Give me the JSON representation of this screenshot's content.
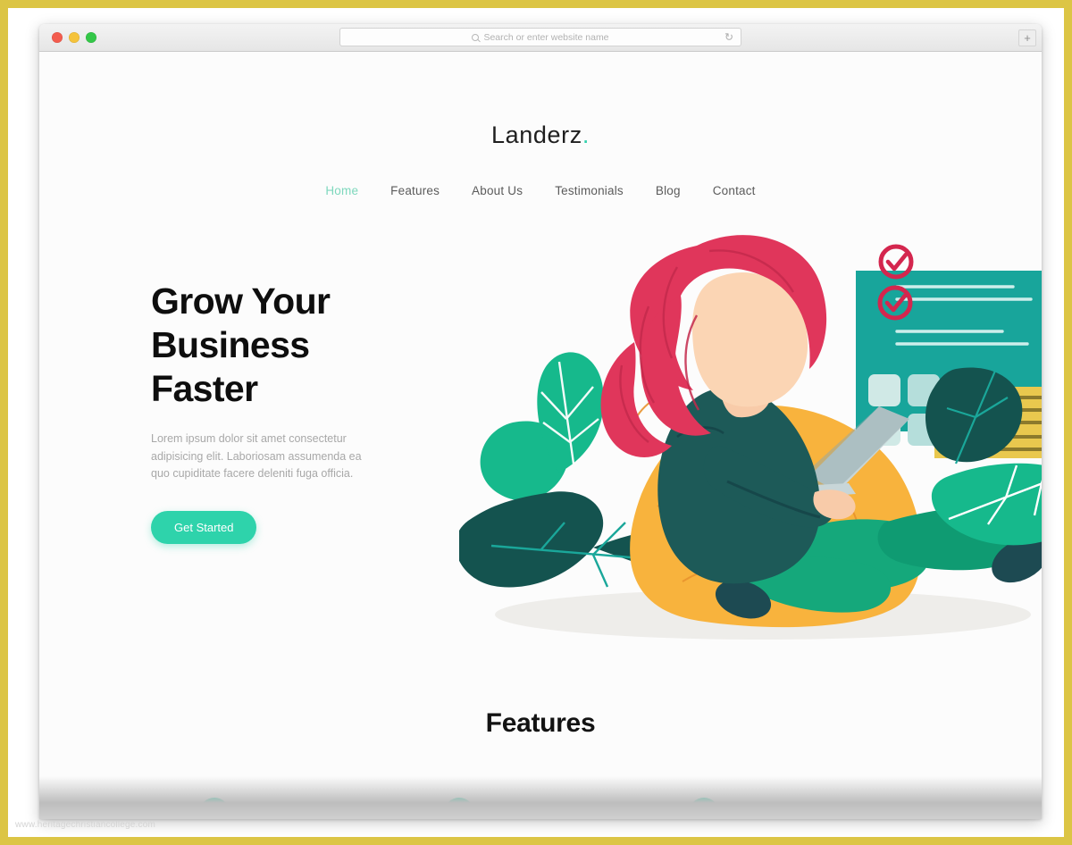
{
  "browser": {
    "window_controls": [
      "close",
      "minimize",
      "maximize"
    ],
    "address_placeholder": "Search or enter website name",
    "search_icon": "search-icon",
    "reload_icon": "reload-icon",
    "newtab_label": "+"
  },
  "site": {
    "logo_text": "Landerz",
    "logo_dot": ".",
    "nav": [
      {
        "label": "Home",
        "active": true
      },
      {
        "label": "Features",
        "active": false
      },
      {
        "label": "About Us",
        "active": false
      },
      {
        "label": "Testimonials",
        "active": false
      },
      {
        "label": "Blog",
        "active": false
      },
      {
        "label": "Contact",
        "active": false
      }
    ],
    "hero": {
      "title_line1": "Grow Your",
      "title_line2": "Business",
      "title_line3": "Faster",
      "subtitle": "Lorem ipsum dolor sit amet consectetur adipisicing elit. Laboriosam assumenda ea quo cupiditate facere deleniti fuga officia.",
      "cta_label": "Get Started"
    },
    "features": {
      "heading": "Features",
      "icons": [
        "check-icon",
        "check-icon",
        "check-icon"
      ]
    },
    "illustration": {
      "name": "woman-on-beanbag-with-laptop-illustration",
      "colors": {
        "accent_teal": "#2ed3ab",
        "panel_teal": "#18a59b",
        "beanbag_orange": "#f8b33d",
        "hair_crimson": "#e0365b",
        "check_crimson": "#d4264e",
        "shirt_dark_teal": "#1d5a58",
        "pants_green": "#15a87b",
        "leaf_dark": "#14534f",
        "card_gold": "#e9c84e",
        "shadow_gray": "#eeeeec",
        "skin": "#f8cba9"
      }
    }
  },
  "watermark": {
    "text": "www.heritagechristiancollege.com"
  },
  "theme": {
    "frame_border": "#dcc545",
    "page_bg": "#fcfcfc",
    "nav_text": "#5b5b5b",
    "nav_active": "#7ed8bd",
    "title_color": "#0e0e0e",
    "sub_color": "#a8a8a8"
  }
}
